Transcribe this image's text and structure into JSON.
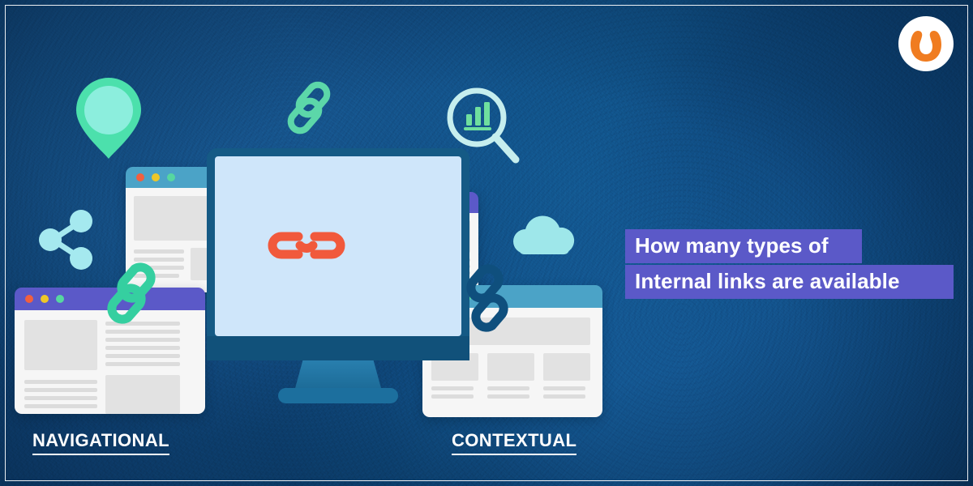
{
  "banner": {
    "background_color": "#10467a",
    "border_color": "#ffffff"
  },
  "logo": {
    "name": "brand-logo",
    "circle_color": "#ffffff",
    "mark_color": "#f07c20",
    "shape": "horseshoe-u-mark"
  },
  "headline": {
    "highlight_color": "#5b59c8",
    "text_color": "#ffffff",
    "line1": "How many types of",
    "line2": "Internal links are available"
  },
  "captions": [
    {
      "id": "navigational",
      "label": "NAVIGATIONAL"
    },
    {
      "id": "contextual",
      "label": "CONTEXTUAL"
    }
  ],
  "illustration": {
    "monitor": {
      "name": "desktop-monitor",
      "bezel_color": "#1a5e8e",
      "bezel_dark_color": "#14496f",
      "screen_color": "#cfe6fa",
      "stand_color": "#2277a6"
    },
    "browser_windows": [
      {
        "id": "top-left",
        "titlebar_color": "#4ba3c7",
        "body_color": "#f6f6f6",
        "dots": [
          "#f2603f",
          "#eec728",
          "#56d7a0"
        ]
      },
      {
        "id": "middle",
        "titlebar_color": "#5b59c8",
        "body_color": "#f6f6f6",
        "dots": [
          "#f2603f",
          "#eec728",
          "#56d7a0"
        ]
      },
      {
        "id": "bottom-left",
        "titlebar_color": "#5b59c8",
        "body_color": "#f6f6f6",
        "dots": [
          "#f2603f",
          "#eec728",
          "#56d7a0"
        ]
      },
      {
        "id": "bottom-right",
        "titlebar_color": "#4ba3c7",
        "body_color": "#f6f6f6",
        "dots": [
          "#f2603f",
          "#eec728",
          "#56d7a0"
        ]
      }
    ],
    "icons": [
      {
        "id": "map-pin",
        "name": "location-pin-icon",
        "color": "#4ce0ac",
        "inner_color": "#8ceedd"
      },
      {
        "id": "share",
        "name": "share-nodes-icon",
        "color": "#a5e9ef"
      },
      {
        "id": "chain-top",
        "name": "chain-link-icon",
        "color": "#5cd7a9"
      },
      {
        "id": "search-chart",
        "name": "search-analytics-icon",
        "color": "#c6eeee",
        "bar_color": "#6fdf9e"
      },
      {
        "id": "cloud",
        "name": "cloud-icon",
        "color": "#9ee7ea"
      },
      {
        "id": "chain-orange",
        "name": "chain-link-icon",
        "color": "#f1593c"
      },
      {
        "id": "chain-green",
        "name": "chain-link-icon",
        "color": "#35cfa0"
      },
      {
        "id": "chain-navy",
        "name": "chain-link-icon",
        "color": "#0f4f7d"
      }
    ]
  }
}
